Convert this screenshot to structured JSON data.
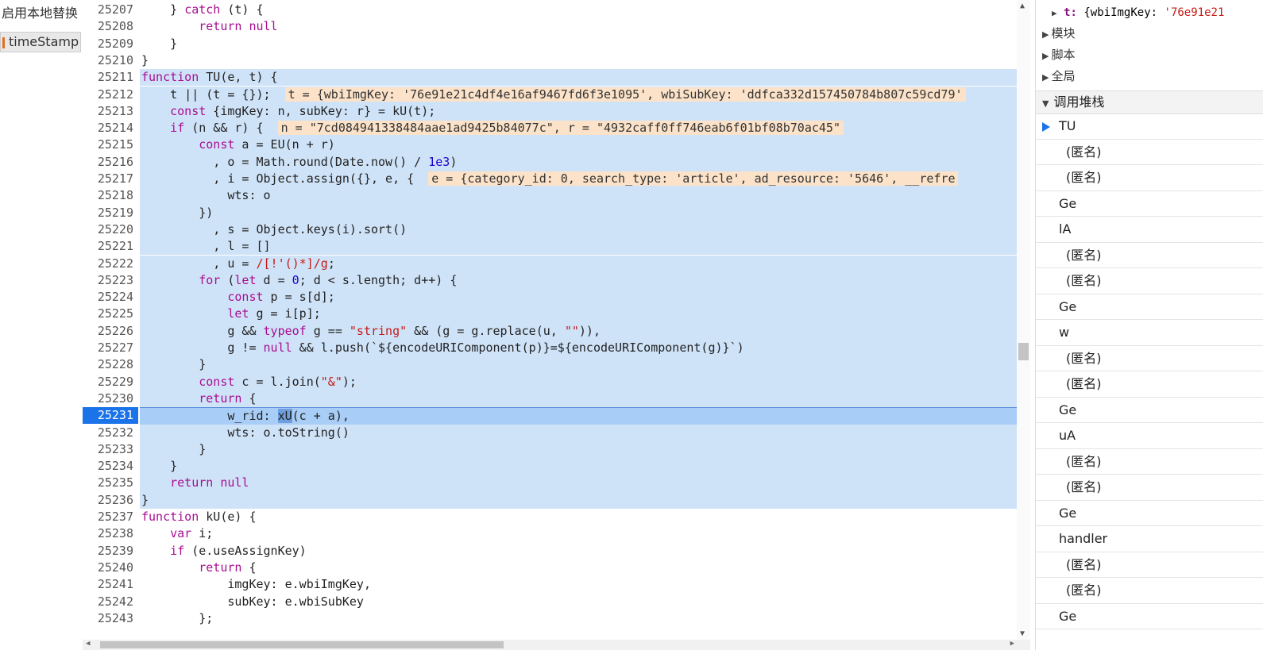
{
  "left_panel": {
    "item1": "启用本地替换",
    "item2": "timeStamp"
  },
  "code_lines": [
    {
      "n": "25207",
      "html": "    } <span class='kw'>catch</span> (t) {"
    },
    {
      "n": "25208",
      "html": "        <span class='kw'>return</span> <span class='kw'>null</span>"
    },
    {
      "n": "25209",
      "html": "    }"
    },
    {
      "n": "25210",
      "html": "}"
    },
    {
      "n": "25211",
      "hl": true,
      "html": "<span class='kw'>function</span> TU(e, t) {"
    },
    {
      "n": "25212",
      "hl": true,
      "html": "    t || (t = {});  <span class='inl'>t = {wbiImgKey: '76e91e21c4df4e16af9467fd6f3e1095', wbiSubKey: 'ddfca332d157450784b807c59cd79'</span>"
    },
    {
      "n": "25213",
      "hl": true,
      "html": "    <span class='kw'>const</span> {imgKey: n, subKey: r} = kU(t);"
    },
    {
      "n": "25214",
      "hl": true,
      "html": "    <span class='kw'>if</span> (n &amp;&amp; r) {  <span class='inl'>n = \"7cd084941338484aae1ad9425b84077c\", r = \"4932caff0ff746eab6f01bf08b70ac45\"</span>"
    },
    {
      "n": "25215",
      "hl": true,
      "html": "        <span class='kw'>const</span> a = EU(n + r)"
    },
    {
      "n": "25216",
      "hl": true,
      "html": "          , o = Math.round(Date.now() / <span class='num'>1e3</span>)"
    },
    {
      "n": "25217",
      "hl": true,
      "html": "          , i = Object.assign({}, e, {  <span class='inl'>e = {category_id: 0, search_type: 'article', ad_resource: '5646', __refre</span>"
    },
    {
      "n": "25218",
      "hl": true,
      "html": "            wts: o"
    },
    {
      "n": "25219",
      "hl": true,
      "html": "        })"
    },
    {
      "n": "25220",
      "hl": true,
      "html": "          , s = Object.keys(i).sort()"
    },
    {
      "n": "25221",
      "hl": true,
      "html": "          , l = []"
    },
    {
      "n": "25222",
      "hl": true,
      "html": "          , u = <span class='re'>/[!'()*]/g</span>;"
    },
    {
      "n": "25223",
      "hl": true,
      "html": "        <span class='kw'>for</span> (<span class='kw'>let</span> d = <span class='num'>0</span>; d &lt; s.length; d++) {"
    },
    {
      "n": "25224",
      "hl": true,
      "html": "            <span class='kw'>const</span> p = s[d];"
    },
    {
      "n": "25225",
      "hl": true,
      "html": "            <span class='kw'>let</span> g = i[p];"
    },
    {
      "n": "25226",
      "hl": true,
      "html": "            g &amp;&amp; <span class='kw'>typeof</span> g == <span class='str'>\"string\"</span> &amp;&amp; (g = g.replace(u, <span class='str'>\"\"</span>)),"
    },
    {
      "n": "25227",
      "hl": true,
      "html": "            g != <span class='kw'>null</span> &amp;&amp; l.push(`${encodeURIComponent(p)}=${encodeURIComponent(g)}`)"
    },
    {
      "n": "25228",
      "hl": true,
      "html": "        }"
    },
    {
      "n": "25229",
      "hl": true,
      "html": "        <span class='kw'>const</span> c = l.join(<span class='str'>\"&amp;\"</span>);"
    },
    {
      "n": "25230",
      "hl": true,
      "html": "        <span class='kw'>return</span> {"
    },
    {
      "n": "25231",
      "cur": true,
      "html": "            w_rid: <span class='sel'>xU</span>(c + a),"
    },
    {
      "n": "25232",
      "hl": true,
      "html": "            wts: o.toString()"
    },
    {
      "n": "25233",
      "hl": true,
      "html": "        }"
    },
    {
      "n": "25234",
      "hl": true,
      "html": "    }"
    },
    {
      "n": "25235",
      "hl": true,
      "html": "    <span class='kw'>return</span> <span class='kw'>null</span>"
    },
    {
      "n": "25236",
      "hl": true,
      "html": "}"
    },
    {
      "n": "25237",
      "html": "<span class='kw'>function</span> kU(e) {"
    },
    {
      "n": "25238",
      "html": "    <span class='kw'>var</span> i;"
    },
    {
      "n": "25239",
      "html": "    <span class='kw'>if</span> (e.useAssignKey)"
    },
    {
      "n": "25240",
      "html": "        <span class='kw'>return</span> {"
    },
    {
      "n": "25241",
      "html": "            imgKey: e.wbiImgKey,"
    },
    {
      "n": "25242",
      "html": "            subKey: e.wbiSubKey"
    },
    {
      "n": "25243",
      "html": "        };"
    }
  ],
  "scope": {
    "t_key": "t:",
    "t_value_prefix": "{wbiImgKey: ",
    "t_value_str": "'76e91e21",
    "sections": [
      "模块",
      "脚本",
      "全局"
    ]
  },
  "call_stack": {
    "title": "调用堆栈",
    "frames": [
      {
        "label": "TU",
        "current": true,
        "anon": false
      },
      {
        "label": "(匿名)",
        "anon": true
      },
      {
        "label": "(匿名)",
        "anon": true
      },
      {
        "label": "Ge",
        "anon": false
      },
      {
        "label": "lA",
        "anon": false
      },
      {
        "label": "(匿名)",
        "anon": true
      },
      {
        "label": "(匿名)",
        "anon": true
      },
      {
        "label": "Ge",
        "anon": false
      },
      {
        "label": "w",
        "anon": false
      },
      {
        "label": "(匿名)",
        "anon": true
      },
      {
        "label": "(匿名)",
        "anon": true
      },
      {
        "label": "Ge",
        "anon": false
      },
      {
        "label": "uA",
        "anon": false
      },
      {
        "label": "(匿名)",
        "anon": true
      },
      {
        "label": "(匿名)",
        "anon": true
      },
      {
        "label": "Ge",
        "anon": false
      },
      {
        "label": "handler",
        "anon": false
      },
      {
        "label": "(匿名)",
        "anon": true
      },
      {
        "label": "(匿名)",
        "anon": true
      },
      {
        "label": "Ge",
        "anon": false
      }
    ]
  }
}
